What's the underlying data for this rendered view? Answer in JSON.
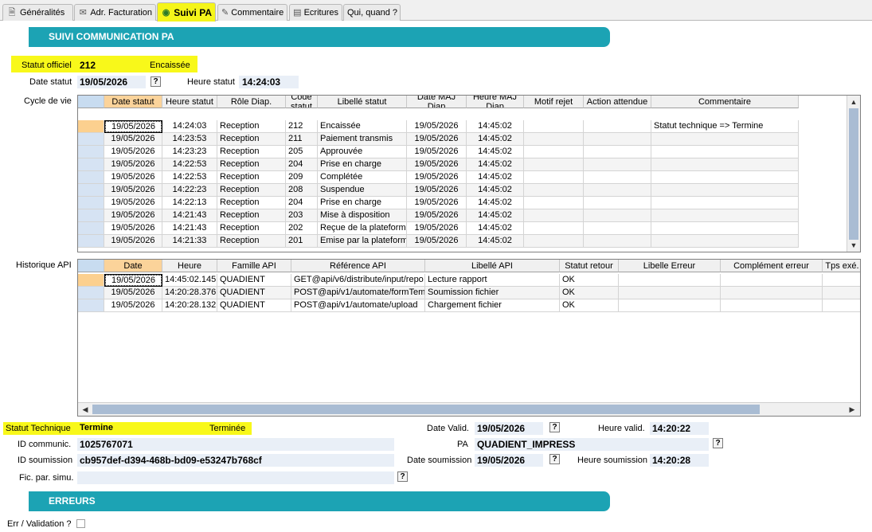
{
  "tabs": [
    {
      "label": "Généralités",
      "icon": "doc-icon"
    },
    {
      "label": "Adr. Facturation",
      "icon": "envelope-icon"
    },
    {
      "label": "Suivi PA",
      "icon": "binoculars-icon"
    },
    {
      "label": "Commentaire",
      "icon": "pen-icon"
    },
    {
      "label": "Ecritures",
      "icon": "ledger-icon"
    },
    {
      "label": "Qui, quand ?",
      "icon": ""
    }
  ],
  "section1": {
    "title": "SUIVI COMMUNICATION PA"
  },
  "statut_officiel": {
    "label": "Statut officiel",
    "code": "212",
    "libelle": "Encaissée"
  },
  "date_statut": {
    "label": "Date statut",
    "value": "19/05/2026",
    "help": "?"
  },
  "heure_statut": {
    "label": "Heure statut",
    "value": "14:24:03"
  },
  "cycle": {
    "label": "Cycle de vie",
    "columns": [
      "Date statut",
      "Heure statut",
      "Rôle Diap.",
      "Code statut",
      "Libellé statut",
      "Date MAJ Diap",
      "Heure MAJ Diap",
      "Motif rejet",
      "Action attendue",
      "Commentaire"
    ],
    "rows": [
      [
        "19/05/2026",
        "14:24:03",
        "Reception",
        "212",
        "Encaissée",
        "19/05/2026",
        "14:45:02",
        "",
        "",
        "Statut technique => Termine"
      ],
      [
        "19/05/2026",
        "14:23:53",
        "Reception",
        "211",
        "Paiement transmis",
        "19/05/2026",
        "14:45:02",
        "",
        "",
        ""
      ],
      [
        "19/05/2026",
        "14:23:23",
        "Reception",
        "205",
        "Approuvée",
        "19/05/2026",
        "14:45:02",
        "",
        "",
        ""
      ],
      [
        "19/05/2026",
        "14:22:53",
        "Reception",
        "204",
        "Prise en charge",
        "19/05/2026",
        "14:45:02",
        "",
        "",
        ""
      ],
      [
        "19/05/2026",
        "14:22:53",
        "Reception",
        "209",
        "Complétée",
        "19/05/2026",
        "14:45:02",
        "",
        "",
        ""
      ],
      [
        "19/05/2026",
        "14:22:23",
        "Reception",
        "208",
        "Suspendue",
        "19/05/2026",
        "14:45:02",
        "",
        "",
        ""
      ],
      [
        "19/05/2026",
        "14:22:13",
        "Reception",
        "204",
        "Prise en charge",
        "19/05/2026",
        "14:45:02",
        "",
        "",
        ""
      ],
      [
        "19/05/2026",
        "14:21:43",
        "Reception",
        "203",
        "Mise à disposition",
        "19/05/2026",
        "14:45:02",
        "",
        "",
        ""
      ],
      [
        "19/05/2026",
        "14:21:43",
        "Reception",
        "202",
        "Reçue de la plateform",
        "19/05/2026",
        "14:45:02",
        "",
        "",
        ""
      ],
      [
        "19/05/2026",
        "14:21:33",
        "Reception",
        "201",
        "Emise par la plateform",
        "19/05/2026",
        "14:45:02",
        "",
        "",
        ""
      ]
    ]
  },
  "historique": {
    "label": "Historique API",
    "columns": [
      "Date",
      "Heure",
      "Famille API",
      "Référence API",
      "Libellé API",
      "Statut retour",
      "Libelle Erreur",
      "Complément erreur",
      "Tps exé."
    ],
    "rows": [
      [
        "19/05/2026",
        "14:45:02.145",
        "QUADIENT",
        "GET@api/v6/distribute/input/repo",
        "Lecture rapport",
        "OK",
        "",
        "",
        ""
      ],
      [
        "19/05/2026",
        "14:20:28.376",
        "QUADIENT",
        "POST@api/v1/automate/formTem",
        "Soumission fichier",
        "OK",
        "",
        "",
        ""
      ],
      [
        "19/05/2026",
        "14:20:28.132",
        "QUADIENT",
        "POST@api/v1/automate/upload",
        "Chargement fichier",
        "OK",
        "",
        "",
        ""
      ]
    ]
  },
  "statut_technique": {
    "label": "Statut Technique",
    "value": "Termine",
    "libelle": "Terminée"
  },
  "date_valid": {
    "label": "Date Valid.",
    "value": "19/05/2026",
    "help": "?"
  },
  "heure_valid": {
    "label": "Heure valid.",
    "value": "14:20:22"
  },
  "id_communic": {
    "label": "ID communic.",
    "value": "1025767071"
  },
  "pa": {
    "label": "PA",
    "value": "QUADIENT_IMPRESS",
    "help": "?"
  },
  "id_soumission": {
    "label": "ID soumission",
    "value": "cb957def-d394-468b-bd09-e53247b768cf"
  },
  "date_soumission": {
    "label": "Date soumission",
    "value": "19/05/2026",
    "help": "?"
  },
  "heure_soumission": {
    "label": "Heure soumission",
    "value": "14:20:28"
  },
  "fic_simu": {
    "label": "Fic. par. simu.",
    "value": "",
    "help": "?"
  },
  "section2": {
    "title": "ERREURS"
  },
  "err_validation": {
    "label": "Err / Validation ?",
    "checked": false
  },
  "colors": {
    "accent": "#1ca3b4",
    "highlight": "#f8f81a",
    "sorted_header": "#fbd39a"
  }
}
